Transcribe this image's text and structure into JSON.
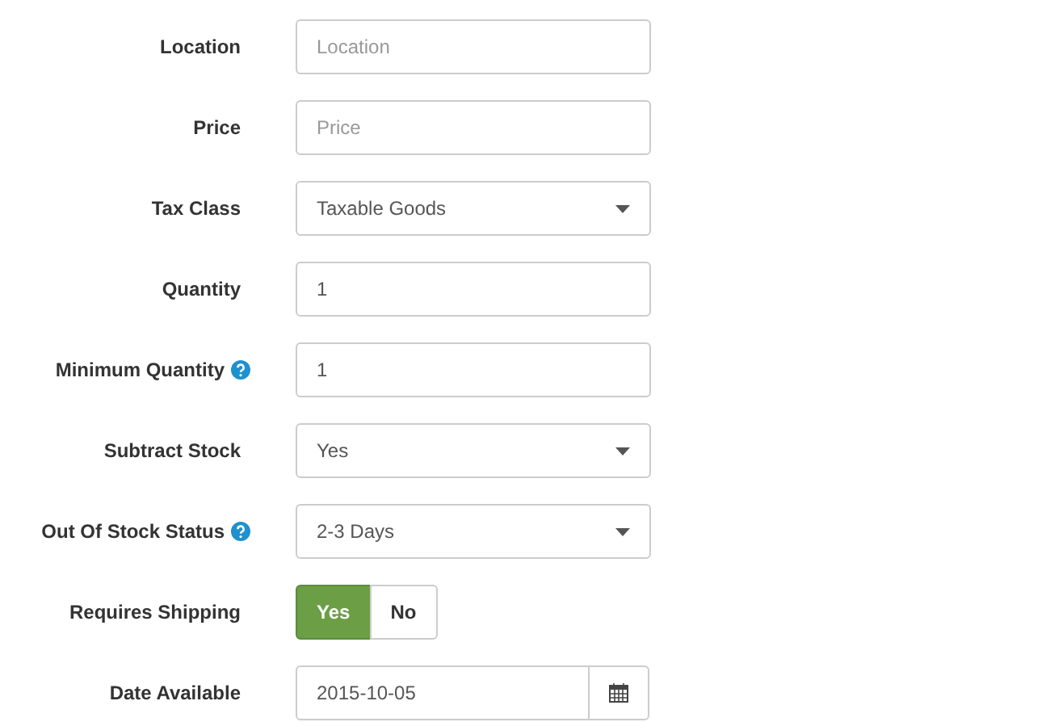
{
  "fields": [
    {
      "label": "Location",
      "help": false,
      "kind": "text",
      "placeholder": "Location"
    },
    {
      "label": "Price",
      "help": false,
      "kind": "text",
      "placeholder": "Price"
    },
    {
      "label": "Tax Class",
      "help": false,
      "kind": "select",
      "value": "Taxable Goods"
    },
    {
      "label": "Quantity",
      "help": false,
      "kind": "text",
      "value": "1"
    },
    {
      "label": "Minimum Quantity",
      "help": true,
      "kind": "text",
      "value": "1"
    },
    {
      "label": "Subtract Stock",
      "help": false,
      "kind": "select",
      "value": "Yes"
    },
    {
      "label": "Out Of Stock Status",
      "help": true,
      "kind": "select",
      "value": "2-3 Days"
    },
    {
      "label": "Requires Shipping",
      "help": false,
      "kind": "toggle",
      "options": [
        {
          "label": "Yes",
          "selected": true
        },
        {
          "label": "No",
          "selected": false
        }
      ]
    },
    {
      "label": "Date Available",
      "help": false,
      "kind": "date",
      "value": "2015-10-05"
    }
  ]
}
